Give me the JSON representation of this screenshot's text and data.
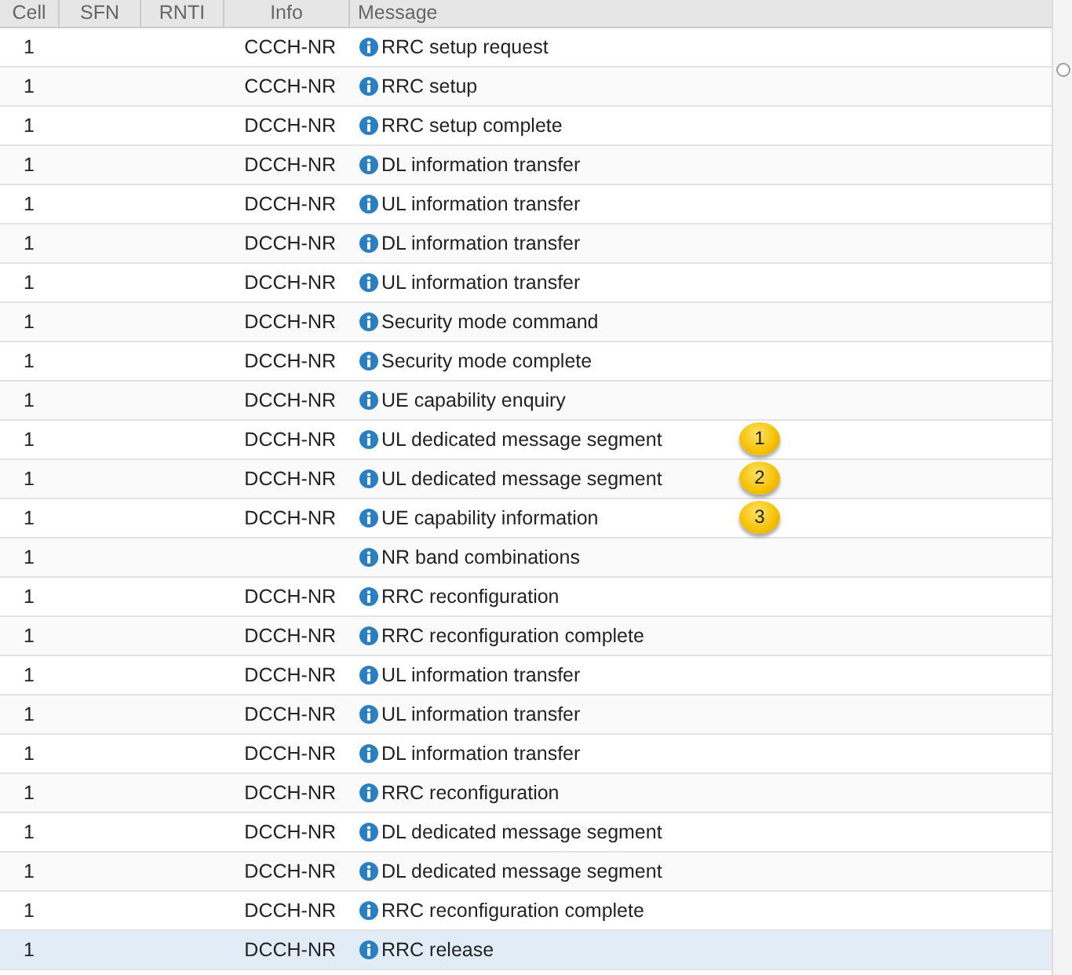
{
  "table": {
    "columns": [
      "Cell",
      "SFN",
      "RNTI",
      "Info",
      "Message"
    ],
    "rows": [
      {
        "cell": "1",
        "info": "CCCH-NR",
        "message": "RRC setup request",
        "selected": false
      },
      {
        "cell": "1",
        "info": "CCCH-NR",
        "message": "RRC setup",
        "selected": false
      },
      {
        "cell": "1",
        "info": "DCCH-NR",
        "message": "RRC setup complete",
        "selected": false
      },
      {
        "cell": "1",
        "info": "DCCH-NR",
        "message": "DL information transfer",
        "selected": false
      },
      {
        "cell": "1",
        "info": "DCCH-NR",
        "message": "UL information transfer",
        "selected": false
      },
      {
        "cell": "1",
        "info": "DCCH-NR",
        "message": "DL information transfer",
        "selected": false
      },
      {
        "cell": "1",
        "info": "DCCH-NR",
        "message": "UL information transfer",
        "selected": false
      },
      {
        "cell": "1",
        "info": "DCCH-NR",
        "message": "Security mode command",
        "selected": false
      },
      {
        "cell": "1",
        "info": "DCCH-NR",
        "message": "Security mode complete",
        "selected": false
      },
      {
        "cell": "1",
        "info": "DCCH-NR",
        "message": "UE capability enquiry",
        "selected": false
      },
      {
        "cell": "1",
        "info": "DCCH-NR",
        "message": "UL dedicated message segment",
        "selected": false,
        "badge": "1"
      },
      {
        "cell": "1",
        "info": "DCCH-NR",
        "message": "UL dedicated message segment",
        "selected": false,
        "badge": "2"
      },
      {
        "cell": "1",
        "info": "DCCH-NR",
        "message": "UE capability information",
        "selected": false,
        "badge": "3"
      },
      {
        "cell": "1",
        "message": "NR band combinations",
        "selected": false
      },
      {
        "cell": "1",
        "info": "DCCH-NR",
        "message": "RRC reconfiguration",
        "selected": false
      },
      {
        "cell": "1",
        "info": "DCCH-NR",
        "message": "RRC reconfiguration complete",
        "selected": false
      },
      {
        "cell": "1",
        "info": "DCCH-NR",
        "message": "UL information transfer",
        "selected": false
      },
      {
        "cell": "1",
        "info": "DCCH-NR",
        "message": "UL information transfer",
        "selected": false
      },
      {
        "cell": "1",
        "info": "DCCH-NR",
        "message": "DL information transfer",
        "selected": false
      },
      {
        "cell": "1",
        "info": "DCCH-NR",
        "message": "RRC reconfiguration",
        "selected": false
      },
      {
        "cell": "1",
        "info": "DCCH-NR",
        "message": "DL dedicated message segment",
        "selected": false
      },
      {
        "cell": "1",
        "info": "DCCH-NR",
        "message": "DL dedicated message segment",
        "selected": false
      },
      {
        "cell": "1",
        "info": "DCCH-NR",
        "message": "RRC reconfiguration complete",
        "selected": false
      },
      {
        "cell": "1",
        "info": "DCCH-NR",
        "message": "RRC release",
        "selected": true
      }
    ]
  }
}
